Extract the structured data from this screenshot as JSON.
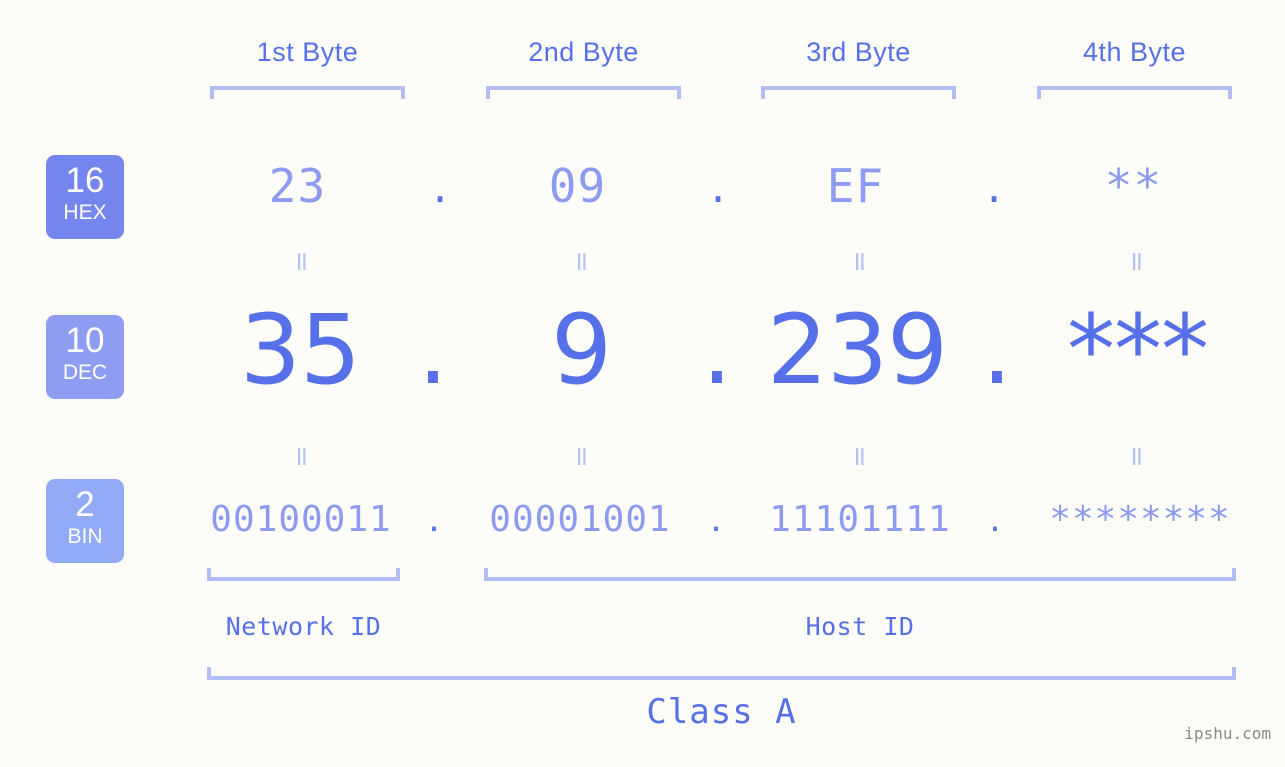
{
  "meta": {
    "background_color": "#fcfdf8",
    "accent_color": "#5570e8",
    "muted_accent_color": "#8c9bf0",
    "bracket_color": "#b3bdf5",
    "watermark_color": "#8a8a8a"
  },
  "byte_headers": [
    {
      "label": "1st Byte"
    },
    {
      "label": "2nd Byte"
    },
    {
      "label": "3rd Byte"
    },
    {
      "label": "4th Byte"
    }
  ],
  "radix_badges": [
    {
      "number": "16",
      "word": "HEX",
      "color": "#7686ef"
    },
    {
      "number": "10",
      "word": "DEC",
      "color": "#8e9cf2"
    },
    {
      "number": "2",
      "word": "BIN",
      "color": "#93aaf6"
    }
  ],
  "rows": {
    "hex": {
      "radix": "16",
      "name": "HEX",
      "values": [
        "23",
        "09",
        "EF",
        "**"
      ]
    },
    "dec": {
      "radix": "10",
      "name": "DEC",
      "values": [
        "35",
        "9",
        "239",
        "***"
      ]
    },
    "bin": {
      "radix": "2",
      "name": "BIN",
      "values": [
        "00100011",
        "00001001",
        "11101111",
        "********"
      ]
    }
  },
  "separators": {
    "dot": "."
  },
  "equals_marks": {
    "symbol": "="
  },
  "segments": {
    "network_id": "Network ID",
    "host_id": "Host ID",
    "class": "Class A"
  },
  "watermark": {
    "text": "ipshu.com"
  }
}
